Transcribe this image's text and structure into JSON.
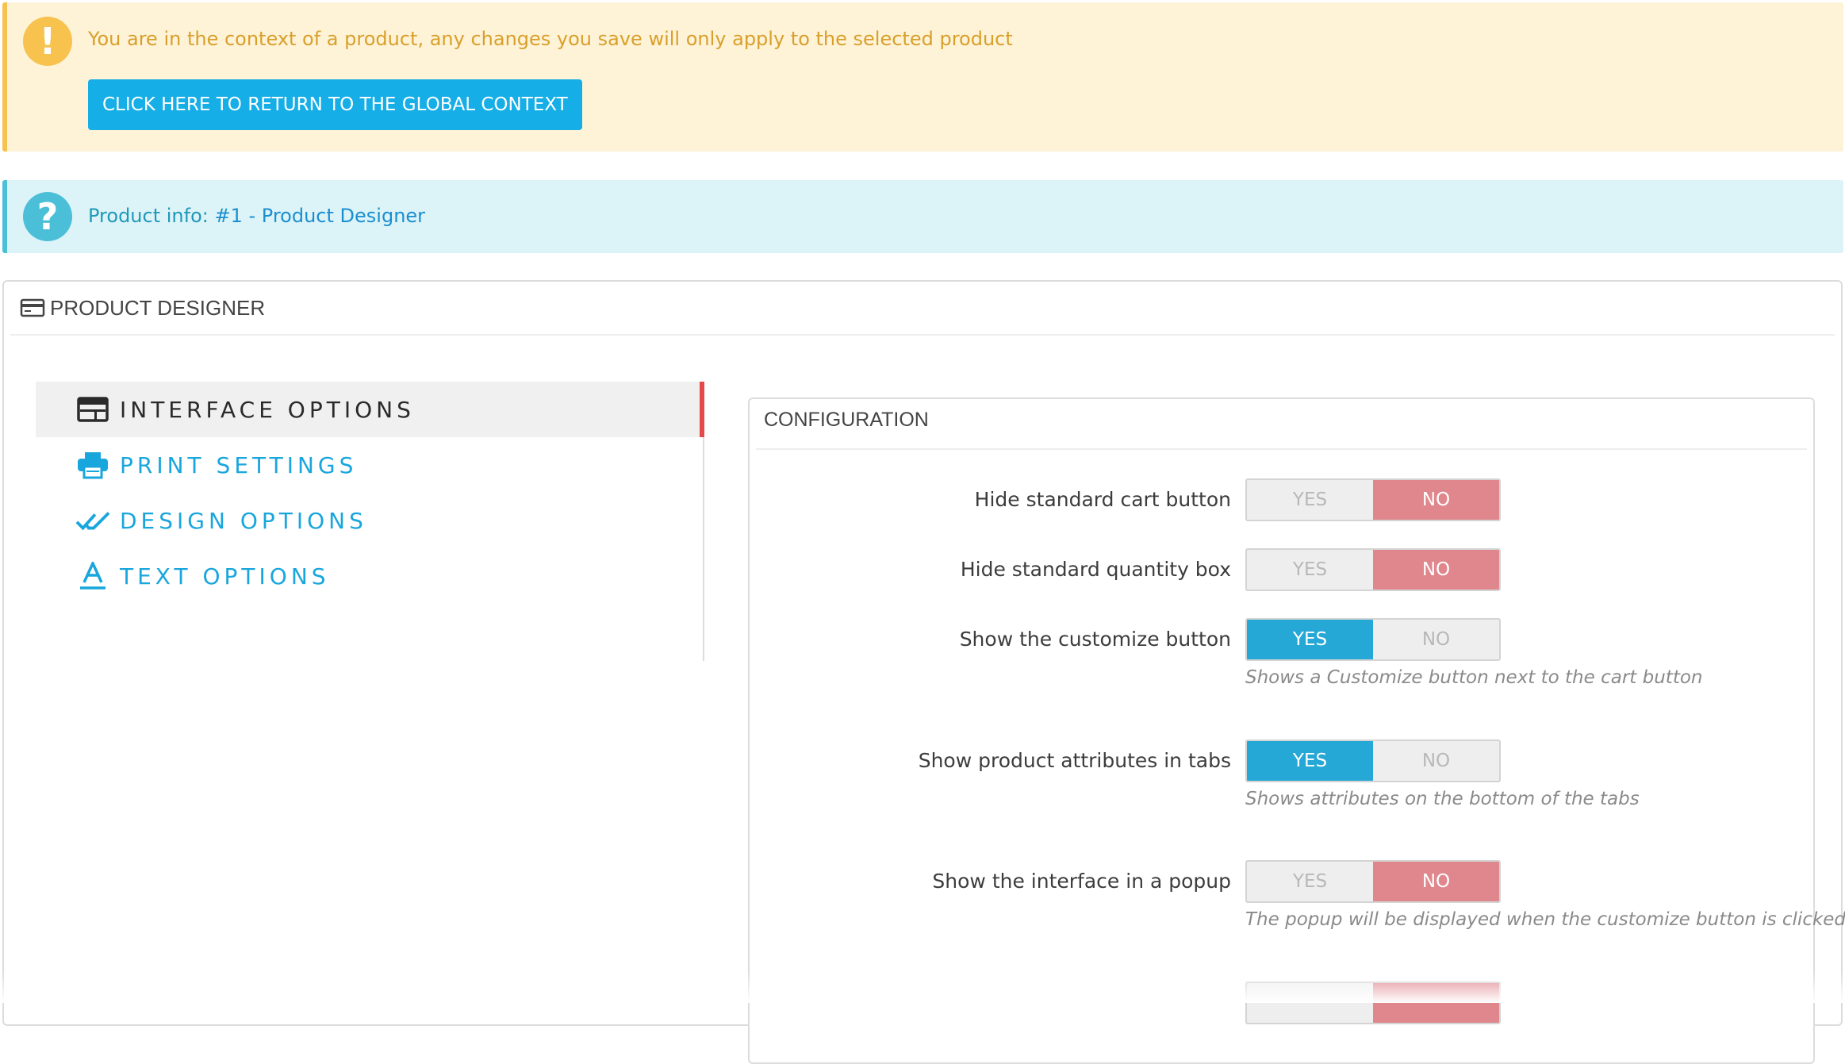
{
  "warning_alert": {
    "message": "You are in the context of a product, any changes you save will only apply to the selected product",
    "button_label": "CLICK HERE TO RETURN TO THE GLOBAL CONTEXT",
    "icon": "exclamation-icon",
    "color": "#f7c24e"
  },
  "info_alert": {
    "prefix": "Product info: ",
    "link_text": "#1 - Product Designer",
    "icon": "question-icon",
    "color": "#4bbfd8"
  },
  "panel": {
    "title": "PRODUCT DESIGNER",
    "icon": "credit-card-icon"
  },
  "sidebar": {
    "items": [
      {
        "label": "INTERFACE OPTIONS",
        "icon": "browser-window-icon",
        "active": true
      },
      {
        "label": "PRINT SETTINGS",
        "icon": "printer-icon",
        "active": false
      },
      {
        "label": "DESIGN OPTIONS",
        "icon": "double-check-icon",
        "active": false
      },
      {
        "label": "TEXT OPTIONS",
        "icon": "text-a-icon",
        "active": false
      }
    ],
    "active_color": "#e54a4a",
    "link_color": "#19a6dc"
  },
  "config": {
    "title": "CONFIGURATION",
    "yes_label": "YES",
    "no_label": "NO",
    "rows": [
      {
        "label": "Hide standard cart button",
        "value": "NO",
        "help": ""
      },
      {
        "label": "Hide standard quantity box",
        "value": "NO",
        "help": ""
      },
      {
        "label": "Show the customize button",
        "value": "YES",
        "help": "Shows a Customize button next to the cart button"
      },
      {
        "label": "Show product attributes in tabs",
        "value": "YES",
        "help": "Shows attributes on the bottom of the tabs"
      },
      {
        "label": "Show the interface in a popup",
        "value": "NO",
        "help": "The popup will be displayed when the customize button is clicked"
      }
    ],
    "yes_color": "#26a8d7",
    "no_color": "#e0878d"
  }
}
